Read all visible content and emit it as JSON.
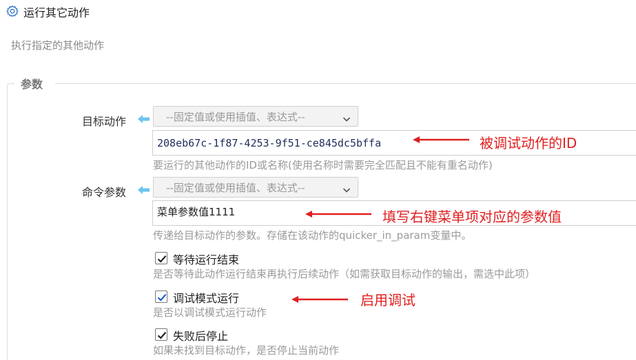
{
  "header": {
    "title": "运行其它动作",
    "subtitle": "执行指定的其他动作"
  },
  "group": {
    "legend": "参数"
  },
  "target_action": {
    "label": "目标动作",
    "select_placeholder": "--固定值或使用插值、表达式--",
    "value": "208eb67c-1f87-4253-9f51-ce845dc5bffa",
    "hint": "要运行的其他动作的ID或名称(使用名称时需要完全匹配且不能有重名动作)"
  },
  "command_param": {
    "label": "命令参数",
    "select_placeholder": "--固定值或使用插值、表达式--",
    "value": "菜单参数值1111",
    "hint": "传递给目标动作的参数。存储在该动作的quicker_in_param变量中。"
  },
  "options": [
    {
      "label": "等待运行结束",
      "checked": true,
      "hint": "是否等待此动作运行结束再执行后续动作（如需获取目标动作的输出，需选中此项）"
    },
    {
      "label": "调试模式运行",
      "checked": true,
      "hint": "是否以调试模式运行动作"
    },
    {
      "label": "失败后停止",
      "checked": true,
      "hint": "如果未找到目标动作，是否停止当前动作"
    }
  ],
  "annotations": {
    "id_note": "被调试动作的ID",
    "param_note": "填写右键菜单项对应的参数值",
    "debug_note": "启用调试"
  },
  "colors": {
    "annotation_red": "#e02020",
    "arrow_blue": "#6cc4ef",
    "checkbox_blue": "#1a73e8"
  },
  "icons": {
    "title_icon": "gear-icon",
    "label_arrow": "arrow-left-icon",
    "select_chevron": "chevron-down-icon",
    "checkbox_mark": "checkmark-icon"
  }
}
